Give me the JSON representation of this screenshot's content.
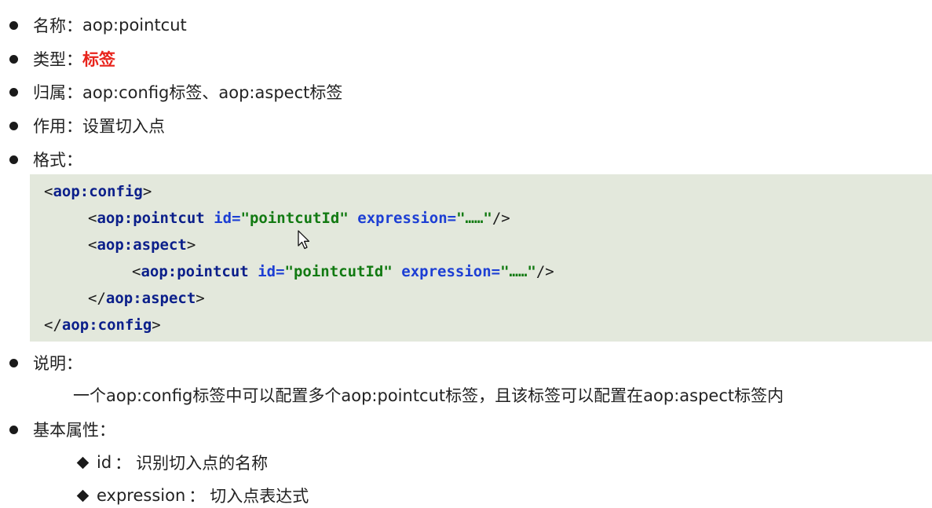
{
  "items": {
    "name": {
      "label": "名称：",
      "value": "aop:pointcut"
    },
    "type": {
      "label": "类型：",
      "value": "标签",
      "value_color": "#e8231b"
    },
    "belongs": {
      "label": "归属：",
      "value": "aop:config标签、aop:aspect标签"
    },
    "purpose": {
      "label": "作用：",
      "value": "设置切入点"
    },
    "format": {
      "label": "格式："
    },
    "description": {
      "label": "说明：",
      "text": "一个aop:config标签中可以配置多个aop:pointcut标签，且该标签可以配置在aop:aspect标签内"
    },
    "attributes": {
      "label": "基本属性：",
      "list": [
        {
          "name": "id",
          "sep": "：",
          "desc": "识别切入点的名称"
        },
        {
          "name": "expression",
          "sep": "：",
          "desc": "切入点表达式"
        }
      ]
    }
  },
  "code": {
    "background": "#e3e8dc",
    "line1": {
      "open": "<",
      "tag": "aop:config",
      "close": ">"
    },
    "line2": {
      "open": "<",
      "tag": "aop:pointcut",
      "attr1": "id=",
      "val1": "\"pointcutId\"",
      "attr2": "expression=",
      "val2": "\"……\"",
      "close": "/>"
    },
    "line3": {
      "open": "<",
      "tag": "aop:aspect",
      "close": ">"
    },
    "line4": {
      "open": "<",
      "tag": "aop:pointcut",
      "attr1": "id=",
      "val1": "\"pointcutId\"",
      "attr2": "expression=",
      "val2": "\"……\"",
      "close": "/>"
    },
    "line5": {
      "open": "</",
      "tag": "aop:aspect",
      "close": ">"
    },
    "line6": {
      "open": "</",
      "tag": "aop:config",
      "close": ">"
    }
  },
  "icons": {
    "bullet": "bullet-dot-icon",
    "diamond": "diamond-bullet-icon",
    "cursor": "mouse-pointer-icon"
  }
}
